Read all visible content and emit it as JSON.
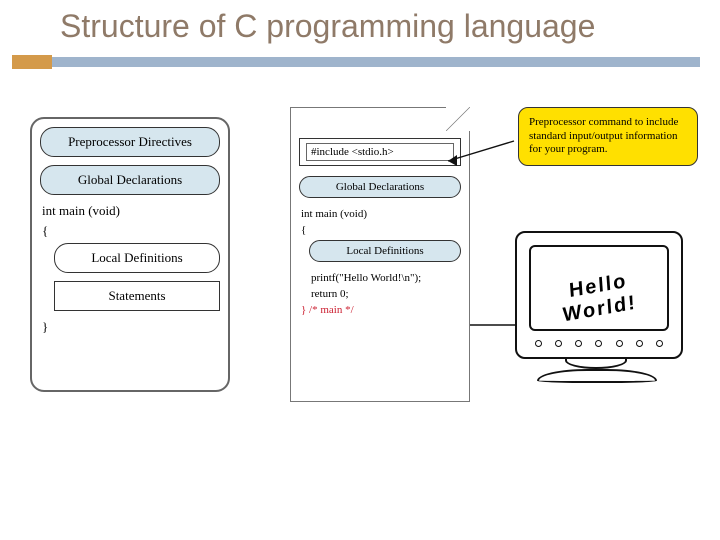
{
  "title": "Structure of C programming language",
  "left": {
    "preprocessor": "Preprocessor Directives",
    "globals": "Global Declarations",
    "main_sig": "int main (void)",
    "open_brace": "{",
    "local_defs": "Local Definitions",
    "statements": "Statements",
    "close_brace": "}"
  },
  "middle": {
    "include_line": "#include <stdio.h>",
    "globals": "Global Declarations",
    "main_sig": "int main (void)",
    "open_brace": "{",
    "local_defs": "Local Definitions",
    "printf_line": "printf(\"Hello World!\\n\");",
    "return_line": "return 0;",
    "close_brace_comment": "} /* main */"
  },
  "callout": "Preprocessor command to include standard input/output information for your program.",
  "monitor": {
    "screen_text": "Hello World!"
  }
}
